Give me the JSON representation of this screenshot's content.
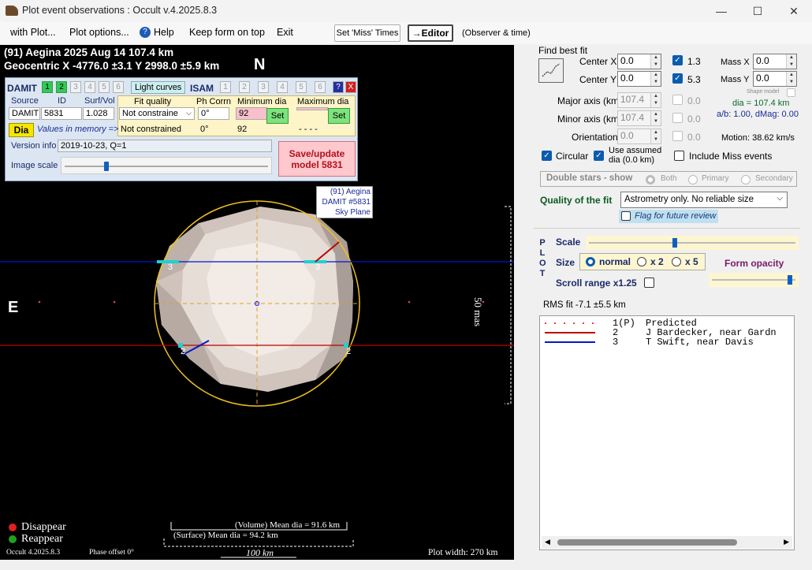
{
  "window": {
    "title": "Plot event observations : Occult v.4.2025.8.3",
    "controls": {
      "minimize": "—",
      "maximize": "☐",
      "close": "✕"
    }
  },
  "menu": {
    "items": [
      "with Plot...",
      "Plot options...",
      "Help",
      "Keep form on top",
      "Exit"
    ],
    "set_miss_times": "Set 'Miss' Times",
    "editor": "→Editor",
    "observer_time": "(Observer & time)"
  },
  "plot": {
    "header_line1": "(91) Aegina  2025 Aug 14   107.4 km",
    "header_line2": "Geocentric  X  -4776.0 ±3.1  Y 2998.0 ±5.9 km",
    "north": "N",
    "east": "E",
    "model_label": [
      "(91) Aegina",
      "DAMIT #5831",
      "Sky Plane"
    ],
    "scale_mas": "50 mas",
    "chord_labels": {
      "left_top": "3",
      "right_top": "3",
      "left_bottom": "2",
      "right_bottom": "2"
    },
    "disappear": "Disappear",
    "reappear": "Reappear",
    "volume_dia": "(Volume) Mean dia = 91.6 km",
    "surface_dia": "(Surface) Mean dia = 94.2 km",
    "scale_km": "100 km",
    "version": "Occult 4.2025.8.3",
    "phase_offset": "Phase offset 0°",
    "plot_width": "Plot width: 270 km"
  },
  "damit": {
    "damit_label": "DAMIT",
    "damit_nums": [
      "1",
      "2",
      "3",
      "4",
      "5",
      "6"
    ],
    "light_curves": "Light curves",
    "isam_label": "ISAM",
    "isam_nums": [
      "1",
      "2",
      "3",
      "4",
      "5",
      "6"
    ],
    "help": "?",
    "close": "X",
    "col_source": "Source",
    "col_id": "ID",
    "col_surfvol": "Surf/Vol",
    "col_fit": "Fit quality",
    "col_phcorr": "Ph Corrn",
    "col_min": "Minimum dia",
    "col_max": "Maximum dia",
    "source": "DAMIT",
    "id": "5831",
    "surfvol": "1.028",
    "fit_quality": "Not constraine",
    "phcorr1": "0°",
    "phcorr2": "0°",
    "min_dia": "92",
    "min_dia2": "92",
    "max_dia2": "- - - -",
    "set": "Set",
    "dia_btn": "Dia",
    "values_memory": "Values in memory =>",
    "not_constrained": "Not constrained",
    "version_label": "Version info",
    "version_value": "2019-10-23, Q=1",
    "image_scale": "Image scale",
    "save_btn": "Save/update model 5831"
  },
  "fit": {
    "title": "Find best fit",
    "center_x_label": "Center X",
    "center_x": "0.0",
    "center_y_label": "Center Y",
    "center_y": "0.0",
    "cx_step": "1.3",
    "cy_step": "5.3",
    "mass_x_label": "Mass X",
    "mass_x": "0.0",
    "mass_y_label": "Mass Y",
    "mass_y": "0.0",
    "shape_model": "Shape model",
    "major_label": "Major axis (km)",
    "major": "107.4",
    "major_step": "0.0",
    "minor_label": "Minor axis (km)",
    "minor": "107.4",
    "minor_step": "0.0",
    "orient_label": "Orientation",
    "orient": "0.0",
    "orient_step": "0.0",
    "dia_text": "dia = 107.4 km",
    "ab_text": "a/b: 1.00, dMag: 0.00",
    "motion": "Motion: 38.62 km/s",
    "circular": "Circular",
    "use_assumed": "Use assumed dia (0.0 km)",
    "include_miss": "Include Miss events",
    "double_stars": "Double stars - show",
    "ds_both": "Both",
    "ds_primary": "Primary",
    "ds_secondary": "Secondary",
    "quality_label": "Quality of the fit",
    "quality_value": "Astrometry only. No reliable size",
    "flag_review": "Flag for future review"
  },
  "plotopts": {
    "plot_letters": [
      "P",
      "L",
      "O",
      "T"
    ],
    "scale": "Scale",
    "size": "Size",
    "normal": "normal",
    "x2": "x 2",
    "x5": "x 5",
    "form_opacity": "Form opacity",
    "scroll_range": "Scroll range x1.25"
  },
  "rms": "RMS fit -7.1 ±5.5 km",
  "legend": [
    {
      "num": "1(P)",
      "name": "Predicted"
    },
    {
      "num": "2",
      "name": "J Bardecker, near Gardn"
    },
    {
      "num": "3",
      "name": "T Swift, near Davis"
    }
  ],
  "colors": {
    "chord2": "#c00000",
    "chord3": "#0018c8",
    "limb": "#f0c020",
    "accent": "#0b5cad"
  }
}
